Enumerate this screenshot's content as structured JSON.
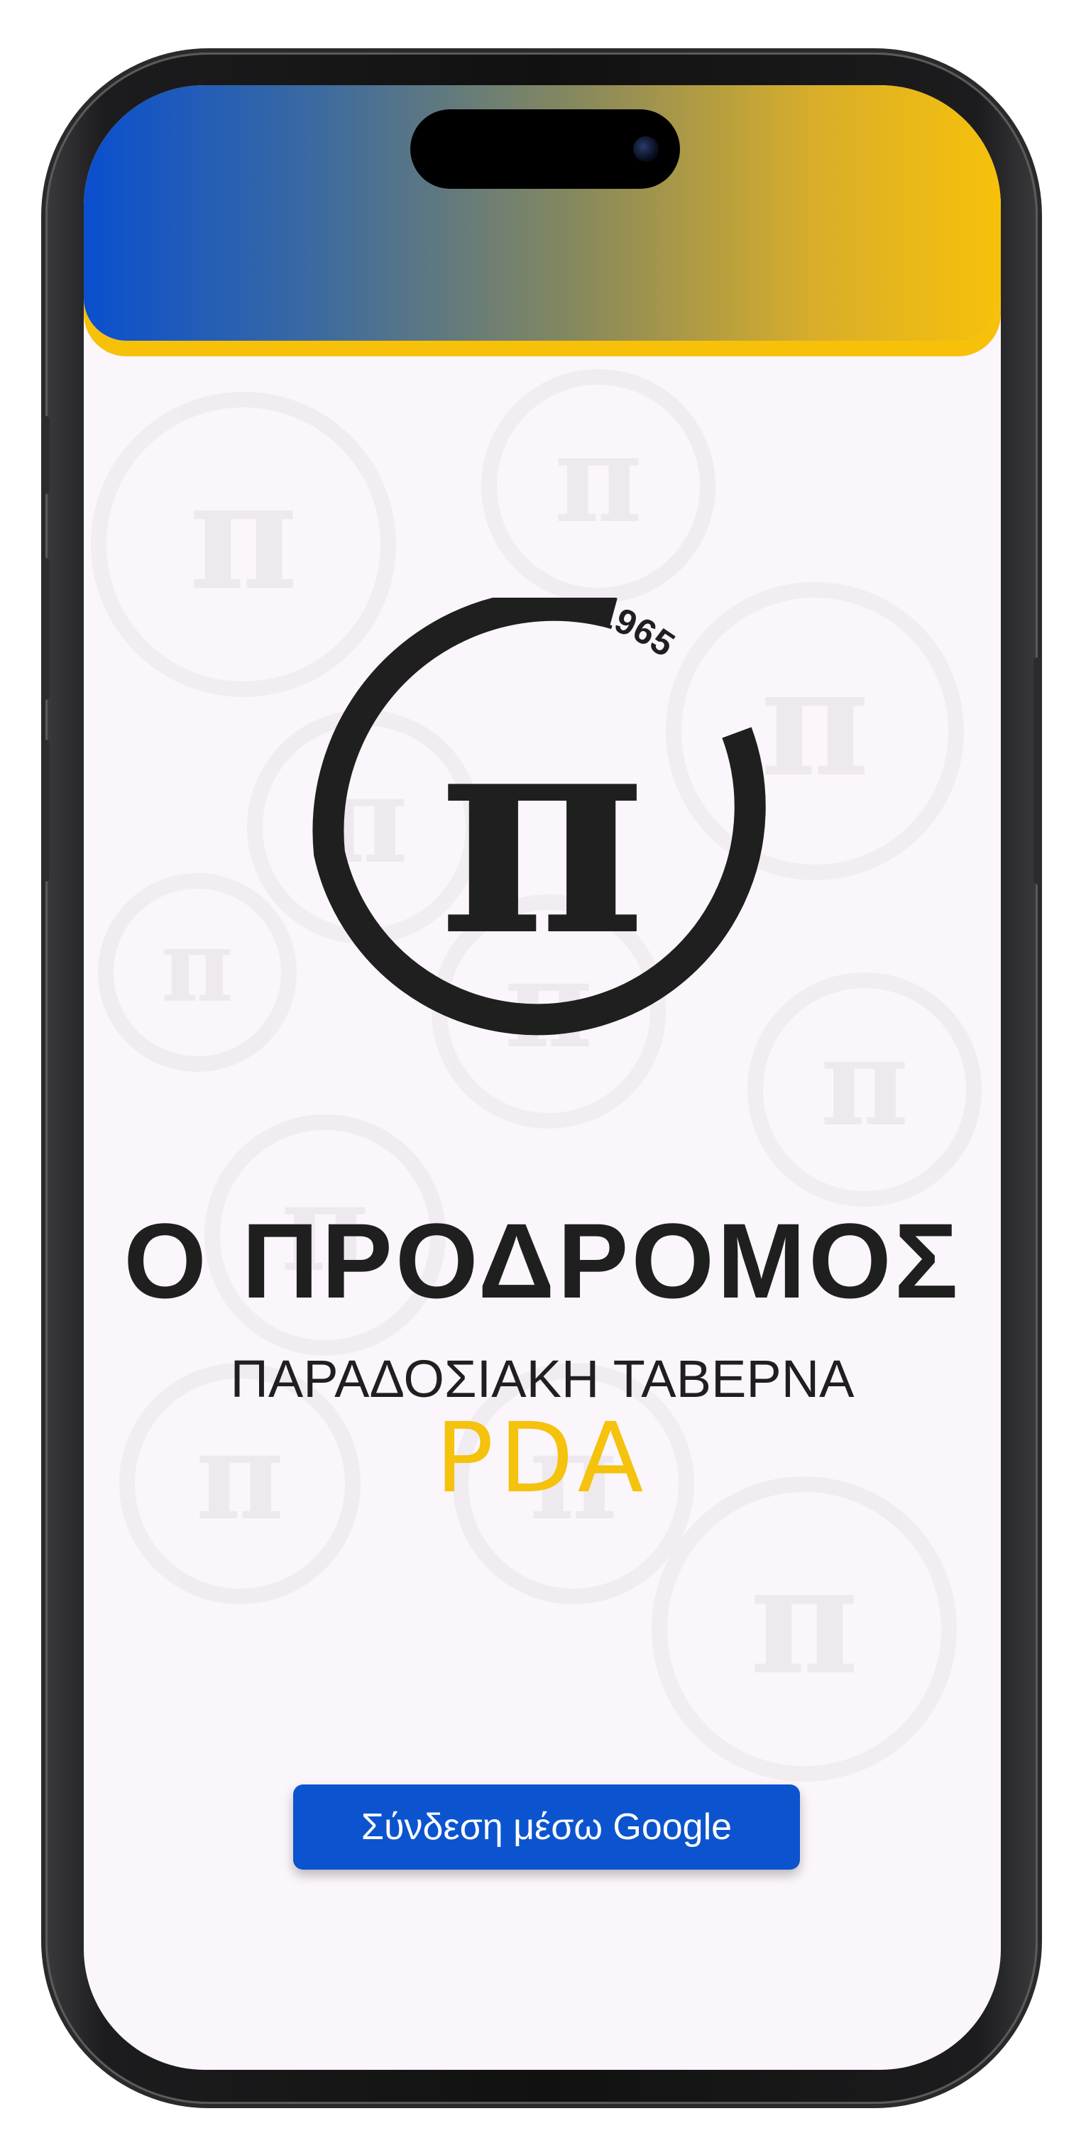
{
  "brand": {
    "logo_year": "1965",
    "logo_symbol": "π",
    "title": "Ο ΠΡΟΔΡΟΜΟΣ",
    "subtitle": "ΠΑΡΑΔΟΣΙΑΚΗ ΤΑΒΕΡΝΑ",
    "tag": "PDA"
  },
  "login": {
    "google_button_label": "Σύνδεση μέσω Google"
  },
  "colors": {
    "header_gradient_start": "#0a4fcf",
    "header_gradient_end": "#f7c10a",
    "accent_yellow": "#f7c10a",
    "button_blue": "#0c54cf",
    "screen_background": "#fbf6fb",
    "logo_dark": "#1f1f1f"
  }
}
